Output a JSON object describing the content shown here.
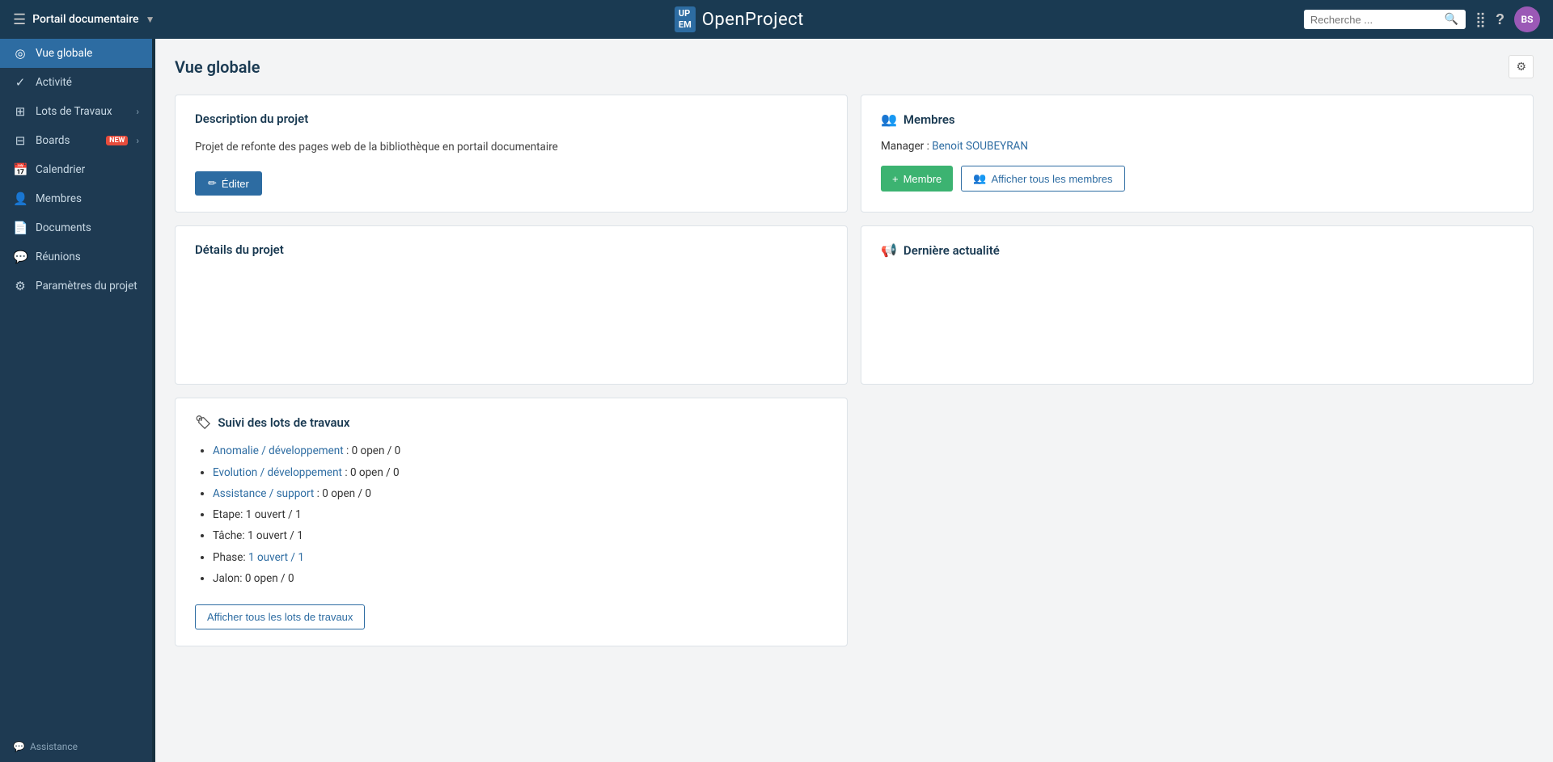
{
  "topbar": {
    "menu_icon": "☰",
    "project_name": "Portail documentaire",
    "dropdown_icon": "▼",
    "logo_badge_line1": "UP",
    "logo_badge_line2": "EM",
    "logo_text": "OpenProject",
    "search_placeholder": "Recherche ...",
    "search_icon": "🔍",
    "grid_icon": "⠿",
    "help_icon": "?",
    "avatar_initials": "BS"
  },
  "sidebar": {
    "items": [
      {
        "id": "vue-globale",
        "icon": "⊙",
        "label": "Vue globale",
        "active": true,
        "arrow": false,
        "new": false
      },
      {
        "id": "activite",
        "icon": "✓",
        "label": "Activité",
        "active": false,
        "arrow": false,
        "new": false
      },
      {
        "id": "lots-de-travaux",
        "icon": "▦",
        "label": "Lots de Travaux",
        "active": false,
        "arrow": true,
        "new": false
      },
      {
        "id": "boards",
        "icon": "▤",
        "label": "Boards",
        "active": false,
        "arrow": true,
        "new": true
      },
      {
        "id": "calendrier",
        "icon": "📅",
        "label": "Calendrier",
        "active": false,
        "arrow": false,
        "new": false
      },
      {
        "id": "membres",
        "icon": "👤",
        "label": "Membres",
        "active": false,
        "arrow": false,
        "new": false
      },
      {
        "id": "documents",
        "icon": "📄",
        "label": "Documents",
        "active": false,
        "arrow": false,
        "new": false
      },
      {
        "id": "reunions",
        "icon": "💬",
        "label": "Réunions",
        "active": false,
        "arrow": false,
        "new": false
      },
      {
        "id": "parametres",
        "icon": "⚙",
        "label": "Paramètres du projet",
        "active": false,
        "arrow": false,
        "new": false
      }
    ],
    "assistance_label": "Assistance"
  },
  "page": {
    "title": "Vue globale",
    "settings_icon": "⚙"
  },
  "description_card": {
    "title": "Description du projet",
    "text": "Projet de refonte des pages web de la bibliothèque en portail documentaire",
    "edit_button": "Éditer",
    "edit_icon": "✏"
  },
  "membres_card": {
    "title": "Membres",
    "icon": "👥",
    "manager_label": "Manager : ",
    "manager_name": "Benoit SOUBEYRAN",
    "add_button": "Membre",
    "add_icon": "+",
    "view_button": "Afficher tous les membres",
    "view_icon": "👥"
  },
  "details_card": {
    "title": "Détails du projet"
  },
  "actualite_card": {
    "title": "Dernière actualité",
    "icon": "📢"
  },
  "suivi_card": {
    "title": "Suivi des lots de travaux",
    "icon": "🏷",
    "items": [
      {
        "link": "Anomalie / développement",
        "suffix": ": 0 open / 0"
      },
      {
        "link": "Evolution / développement",
        "suffix": ": 0 open / 0"
      },
      {
        "link": "Assistance / support",
        "suffix": ": 0 open / 0"
      },
      {
        "link": null,
        "prefix": "Etape: ",
        "value": "1 ouvert / 1"
      },
      {
        "link": null,
        "prefix": "Tâche: ",
        "value": "1 ouvert / 1"
      },
      {
        "link": null,
        "prefix": "Phase: ",
        "suffix_link": "1 ouvert / 1"
      },
      {
        "link": null,
        "prefix": "Jalon: ",
        "value": "0 open / 0"
      }
    ],
    "show_button": "Afficher tous les lots de travaux"
  }
}
